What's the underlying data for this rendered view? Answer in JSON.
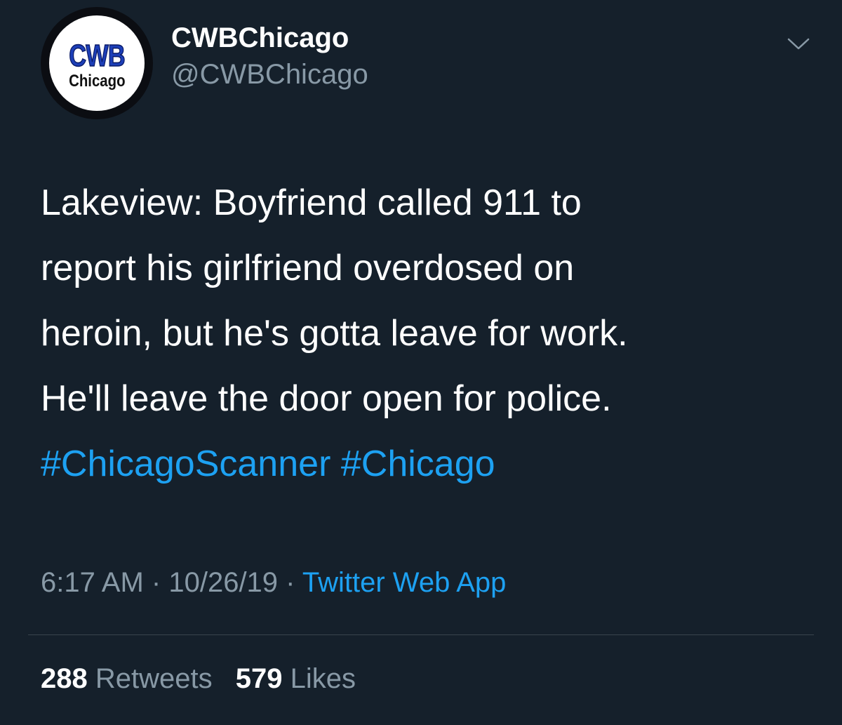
{
  "tweet": {
    "author": {
      "display_name": "CWBChicago",
      "handle": "@CWBChicago",
      "avatar_logo": {
        "top": "CWB",
        "bottom": "Chicago"
      }
    },
    "menu_icon": "chevron-down-icon",
    "text_lines": [
      "Lakeview: Boyfriend called 911 to",
      "report his girlfriend overdosed on",
      "heroin, but he's gotta leave for work.",
      "He'll leave the door open for police."
    ],
    "hashtags": [
      "#ChicagoScanner",
      "#Chicago"
    ],
    "time": "6:17 AM",
    "date": "10/26/19",
    "separator": "·",
    "source": "Twitter Web App",
    "stats": {
      "retweets_count": "288",
      "retweets_label": "Retweets",
      "likes_count": "579",
      "likes_label": "Likes"
    }
  },
  "colors": {
    "background": "#15202b",
    "text_primary": "#ffffff",
    "text_secondary": "#8899a6",
    "link": "#1da1f2",
    "divider": "#38444d"
  }
}
